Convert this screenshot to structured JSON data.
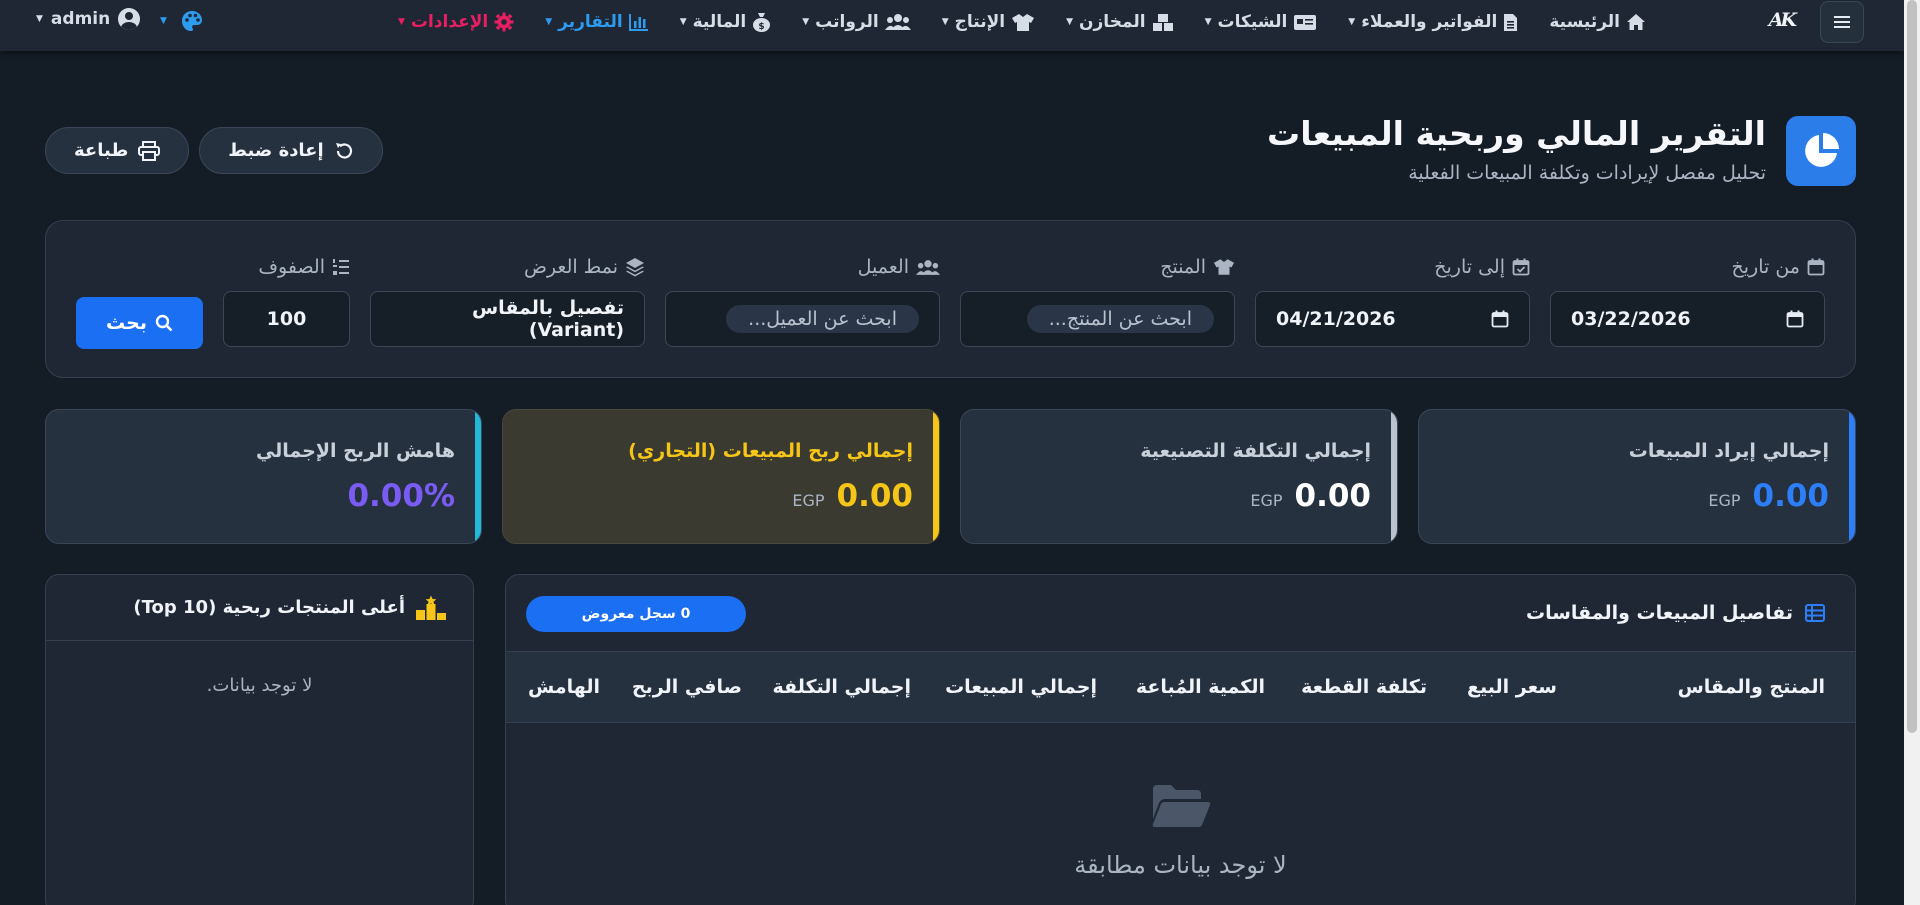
{
  "navbar": {
    "brand": "AK",
    "items": [
      {
        "label": "الرئيسية",
        "icon": "home-icon",
        "dropdown": false
      },
      {
        "label": "الفواتير والعملاء",
        "icon": "invoice-icon",
        "dropdown": true
      },
      {
        "label": "الشيكات",
        "icon": "check-card-icon",
        "dropdown": true
      },
      {
        "label": "المخازن",
        "icon": "warehouse-icon",
        "dropdown": true
      },
      {
        "label": "الإنتاج",
        "icon": "shirt-icon",
        "dropdown": true
      },
      {
        "label": "الرواتب",
        "icon": "users-icon",
        "dropdown": true
      },
      {
        "label": "المالية",
        "icon": "money-bag-icon",
        "dropdown": true
      },
      {
        "label": "التقارير",
        "icon": "bar-chart-icon",
        "dropdown": true
      },
      {
        "label": "الإعدادات",
        "icon": "gear-icon",
        "dropdown": true
      }
    ],
    "user": "admin"
  },
  "header": {
    "title": "التقرير المالي وربحية المبيعات",
    "subtitle": "تحليل مفصل لإيرادات وتكلفة المبيعات الفعلية",
    "icon": "pie-chart-icon"
  },
  "actions": {
    "print": "طباعة",
    "reset": "إعادة ضبط"
  },
  "filters": {
    "from_date": {
      "label": "من تاريخ",
      "value": "03/22/2026"
    },
    "to_date": {
      "label": "إلى تاريخ",
      "value": "04/21/2026"
    },
    "product": {
      "label": "المنتج",
      "placeholder": "ابحث عن المنتج..."
    },
    "customer": {
      "label": "العميل",
      "placeholder": "ابحث عن العميل..."
    },
    "view_mode": {
      "label": "نمط العرض",
      "value": "تفصيل بالمقاس (Variant)"
    },
    "rows": {
      "label": "الصفوف",
      "value": "100"
    },
    "search_button": "بحث"
  },
  "stats": [
    {
      "title": "إجمالي إيراد المبيعات",
      "value": "0.00",
      "currency": "EGP",
      "color": "#2d7ff9"
    },
    {
      "title": "إجمالي التكلفة التصنيعية",
      "value": "0.00",
      "currency": "EGP",
      "color": "#b9c2ce"
    },
    {
      "title": "إجمالي ربح المبيعات (التجاري)",
      "value": "0.00",
      "currency": "EGP",
      "color": "#f5c518"
    },
    {
      "title": "هامش الربح الإجمالي",
      "value": "0.00%",
      "currency": "",
      "color": "#7a5cf5"
    }
  ],
  "top_products": {
    "title": "أعلى المنتجات ربحية (Top 10)",
    "empty": "لا توجد بيانات."
  },
  "details": {
    "title": "تفاصيل المبيعات والمقاسات",
    "count_badge": "0 سجل معروض",
    "columns": [
      "المنتج والمقاس",
      "سعر البيع",
      "تكلفة القطعة",
      "الكمية المُباعة",
      "إجمالي المبيعات",
      "إجمالي التكلفة",
      "صافي الربح",
      "الهامش"
    ],
    "empty": "لا توجد بيانات مطابقة"
  }
}
